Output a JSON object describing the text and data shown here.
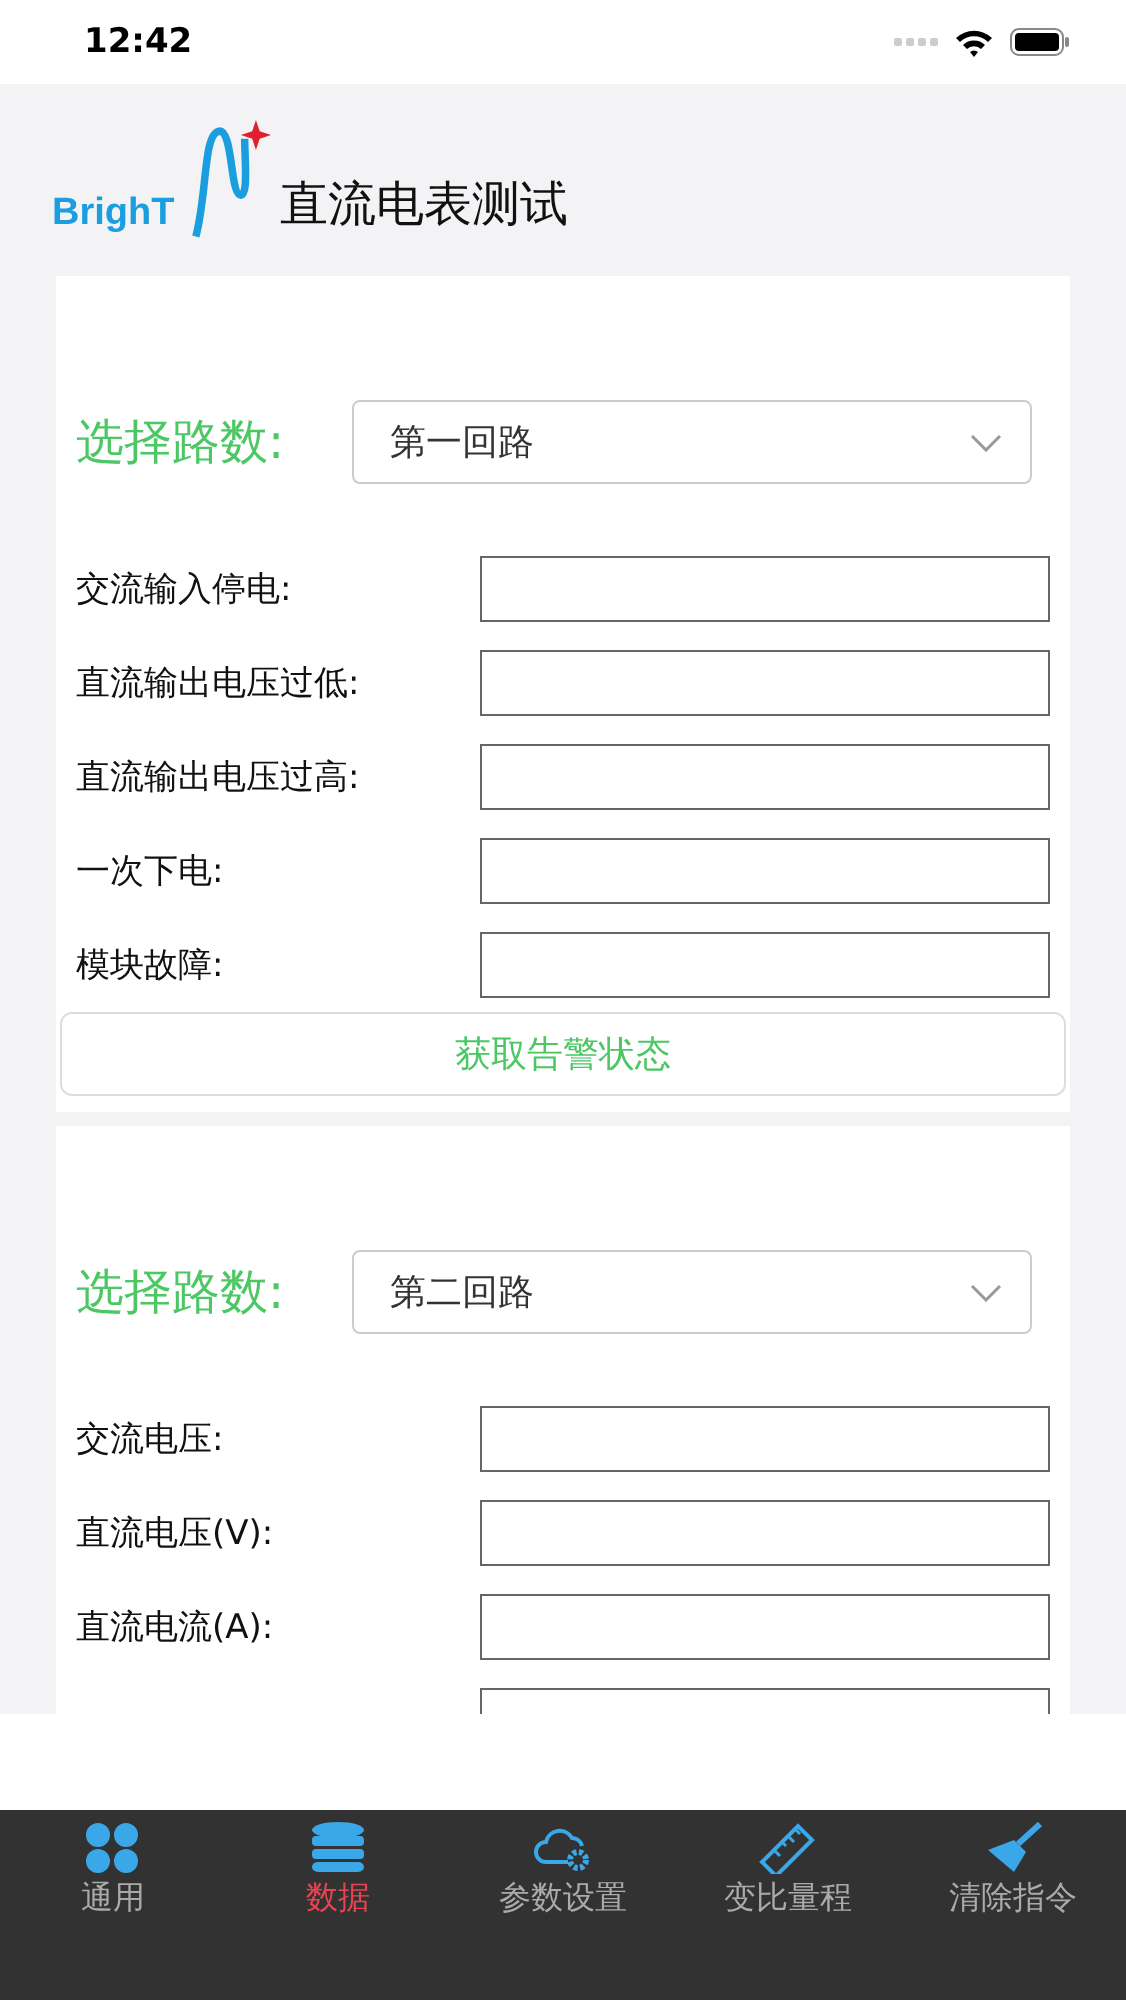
{
  "status_bar": {
    "time": "12:42"
  },
  "header": {
    "logo_text": "BrighT",
    "title": "直流电表测试"
  },
  "sections": [
    {
      "select_label": "选择路数:",
      "select_value": "第一回路",
      "fields": [
        {
          "kind": "text_input",
          "label": "交流输入停电:"
        },
        {
          "kind": "text_input",
          "label": "直流输出电压过低:"
        },
        {
          "kind": "text_input",
          "label": "直流输出电压过高:"
        },
        {
          "kind": "text_input",
          "label": "一次下电:"
        },
        {
          "kind": "text_input",
          "label": "模块故障:"
        }
      ],
      "button": "获取告警状态"
    },
    {
      "select_label": "选择路数:",
      "select_value": "第二回路",
      "fields": [
        {
          "kind": "text_input",
          "label": "交流电压:"
        },
        {
          "kind": "text_input",
          "label": "直流电压(V):"
        },
        {
          "kind": "text_input",
          "label": "直流电流(A):"
        },
        {
          "kind": "text_input"
        }
      ]
    }
  ],
  "tabs": [
    {
      "label": "通用",
      "kind": "grid",
      "selected": false
    },
    {
      "label": "数据",
      "kind": "database",
      "selected": true
    },
    {
      "label": "参数设置",
      "kind": "cloud",
      "selected": false
    },
    {
      "label": "变比量程",
      "kind": "ruler",
      "selected": false
    },
    {
      "label": "清除指令",
      "kind": "broom",
      "selected": false
    }
  ]
}
